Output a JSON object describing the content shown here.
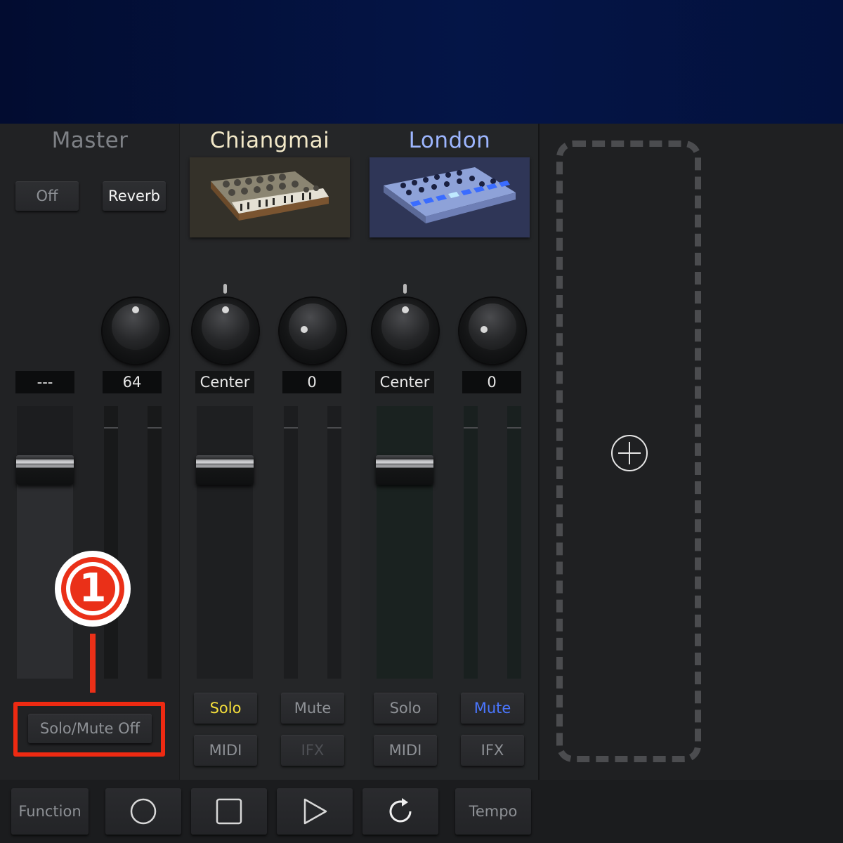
{
  "channels": {
    "master": {
      "title": "Master",
      "fx_buttons": [
        "Off",
        "Reverb"
      ],
      "readout_left": "---",
      "readout_right": "64",
      "solo_mute": "Solo/Mute Off"
    },
    "ch1": {
      "title": "Chiangmai",
      "pan": "Center",
      "send": "0",
      "solo": "Solo",
      "mute": "Mute",
      "midi": "MIDI",
      "ifx": "IFX"
    },
    "ch2": {
      "title": "London",
      "pan": "Center",
      "send": "0",
      "solo": "Solo",
      "mute": "Mute",
      "midi": "MIDI",
      "ifx": "IFX"
    }
  },
  "transport": {
    "function": "Function",
    "tempo": "Tempo",
    "buttons": [
      "circle-icon",
      "stop-icon",
      "play-icon",
      "loop-icon"
    ]
  },
  "annotation": {
    "number": "1"
  },
  "colors": {
    "solo_active": "#f5df3b",
    "mute_active": "#4a76ff",
    "annotation": "#ea3018",
    "header": "#041547"
  }
}
